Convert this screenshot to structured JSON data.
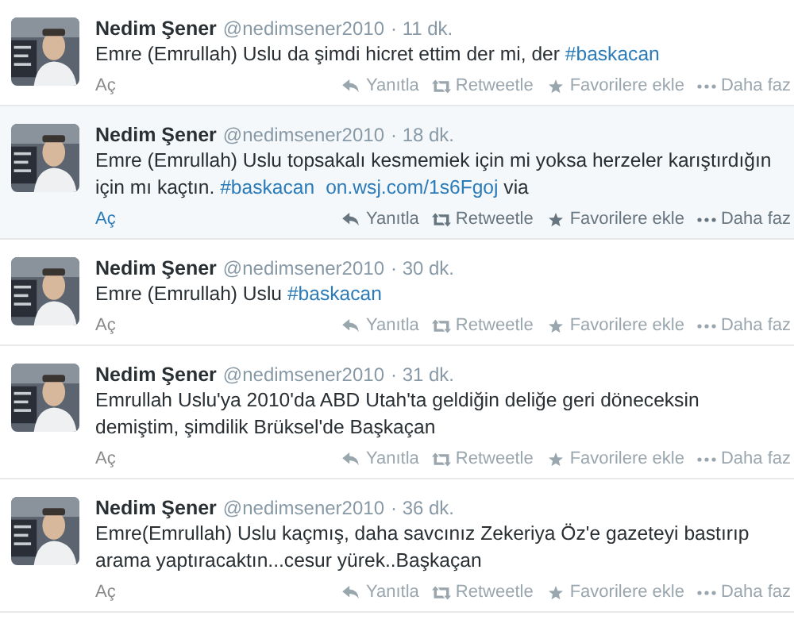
{
  "tweets": [
    {
      "name": "Nedim Şener",
      "handle": "@nedimsener2010",
      "time": "· 11 dk.",
      "hovered": false,
      "parts": [
        {
          "kind": "text",
          "text": "Emre (Emrullah) Uslu da şimdi hicret ettim der mi, der "
        },
        {
          "kind": "link",
          "text": "#baskacan"
        }
      ],
      "expand": "Aç",
      "actions": [
        "Yanıtla",
        "Retweetle",
        "Favorilere ekle",
        "Daha faz"
      ]
    },
    {
      "name": "Nedim Şener",
      "handle": "@nedimsener2010",
      "time": "· 18 dk.",
      "hovered": true,
      "parts": [
        {
          "kind": "text",
          "text": "Emre (Emrullah) Uslu topsakalı kesmemiek için mi yoksa herzeler karıştırdığın için mı kaçtın. "
        },
        {
          "kind": "link",
          "text": "#baskacan"
        },
        {
          "kind": "link",
          "text": "on.wsj.com/1s6Fgoj"
        },
        {
          "kind": "text",
          "text": " via"
        }
      ],
      "expand": "Aç",
      "actions": [
        "Yanıtla",
        "Retweetle",
        "Favorilere ekle",
        "Daha faz"
      ]
    },
    {
      "name": "Nedim Şener",
      "handle": "@nedimsener2010",
      "time": "· 30 dk.",
      "hovered": false,
      "parts": [
        {
          "kind": "text",
          "text": "Emre (Emrullah) Uslu "
        },
        {
          "kind": "link",
          "text": "#baskacan"
        }
      ],
      "expand": "Aç",
      "actions": [
        "Yanıtla",
        "Retweetle",
        "Favorilere ekle",
        "Daha faz"
      ]
    },
    {
      "name": "Nedim Şener",
      "handle": "@nedimsener2010",
      "time": "· 31 dk.",
      "hovered": false,
      "parts": [
        {
          "kind": "text",
          "text": "Emrullah Uslu'ya 2010'da ABD Utah'ta geldiğin deliğe geri döneceksin demiştim, şimdilik Brüksel'de Başkaçan"
        }
      ],
      "expand": "Aç",
      "actions": [
        "Yanıtla",
        "Retweetle",
        "Favorilere ekle",
        "Daha faz"
      ]
    },
    {
      "name": "Nedim Şener",
      "handle": "@nedimsener2010",
      "time": "· 36 dk.",
      "hovered": false,
      "parts": [
        {
          "kind": "text",
          "text": "Emre(Emrullah) Uslu kaçmış, daha savcınız Zekeriya Öz'e gazeteyi bastırıp arama yaptıracaktın...cesur yürek..Başkaçan"
        }
      ],
      "expand": "Aç",
      "actions": [
        "Yanıtla",
        "Retweetle",
        "Favorilere ekle",
        "Daha faz"
      ]
    }
  ]
}
